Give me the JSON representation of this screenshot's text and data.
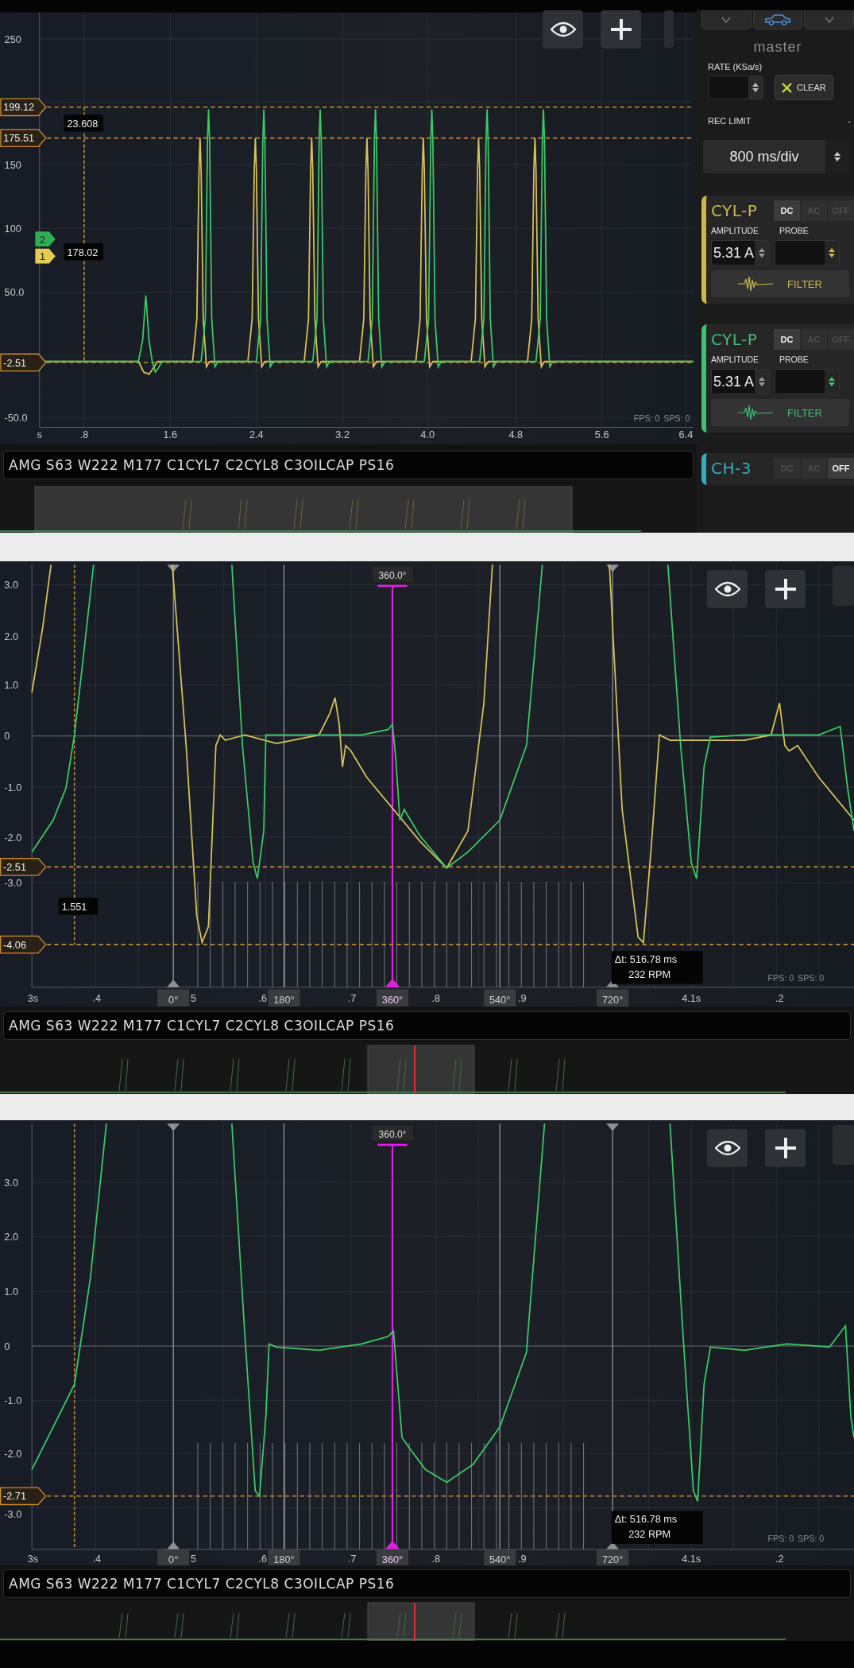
{
  "panels": [
    {
      "kind": "overview",
      "y_ticks": [
        "250",
        "150",
        "100",
        "50.0",
        "-50.0"
      ],
      "x_ticks": [
        "s",
        ".8",
        "1.6",
        "2.4",
        "3.2",
        "4.0",
        "4.8",
        "5.6",
        "6.4"
      ],
      "level_cursors": [
        "199.12",
        "175.51",
        "-2.51"
      ],
      "readouts": [
        "23.608",
        "178.02"
      ],
      "channel_markers": [
        {
          "label": "2",
          "color": "#2fae55"
        },
        {
          "label": "1",
          "color": "#e3cc55"
        }
      ],
      "fps": "FPS: 0",
      "sps": "SPS: 0",
      "title": "AMG S63 W222 M177 C1CYL7 C2CYL8 C3OILCAP PS16"
    },
    {
      "kind": "zoomed",
      "y_ticks": [
        "3.0",
        "2.0",
        "1.0",
        "0",
        "-1.0",
        "-2.0",
        "-3.0"
      ],
      "x_ticks": [
        "3s",
        ".4",
        "5",
        ".6",
        ".7",
        ".8",
        ".9",
        "4.1s",
        ".2"
      ],
      "level_cursors": [
        "-2.51",
        "-4.06"
      ],
      "readouts": [
        "1.551"
      ],
      "angle_markers": [
        "0°",
        "180°",
        "360°",
        "540°",
        "720°"
      ],
      "cursor_label": "360.0°",
      "delta": "Δt: 516.78 ms",
      "rpm": "232 RPM",
      "fps": "FPS: 0",
      "sps": "SPS: 0",
      "title": "AMG S63 W222 M177 C1CYL7 C2CYL8 C3OILCAP PS16"
    },
    {
      "kind": "zoomed",
      "y_ticks": [
        "3.0",
        "2.0",
        "1.0",
        "0",
        "-1.0",
        "-2.0",
        "-3.0"
      ],
      "x_ticks": [
        "3s",
        ".4",
        "5",
        ".6",
        ".7",
        ".8",
        ".9",
        "4.1s",
        ".2"
      ],
      "level_cursors": [
        "-2.71"
      ],
      "angle_markers": [
        "0°",
        "180°",
        "360°",
        "540°",
        "720°"
      ],
      "cursor_label": "360.0°",
      "delta": "Δt: 516.78 ms",
      "rpm": "232 RPM",
      "fps": "FPS: 0",
      "sps": "SPS: 0",
      "title": "AMG S63 W222 M177 C1CYL7 C2CYL8 C3OILCAP PS16"
    }
  ],
  "control_panel": {
    "title": "master",
    "rate_label": "RATE (KSa/s)",
    "clear_button": "CLEAR",
    "rec_limit_label": "REC LIMIT",
    "rec_limit_value": "-",
    "timebase": "800 ms/div",
    "channels": [
      {
        "name": "CYL-P",
        "color": "#c9b94d",
        "expanded": true,
        "amplitude_label": "AMPLITUDE",
        "probe_label": "PROBE",
        "amplitude": "5.31 A",
        "filter": "FILTER",
        "couplings": [
          {
            "label": "DC",
            "selected": true
          },
          {
            "label": "AC",
            "selected": false
          },
          {
            "label": "OFF",
            "selected": false
          }
        ]
      },
      {
        "name": "CYL-P",
        "color": "#3fbf78",
        "expanded": true,
        "amplitude_label": "AMPLITUDE",
        "probe_label": "PROBE",
        "amplitude": "5.31 A",
        "filter": "FILTER",
        "couplings": [
          {
            "label": "DC",
            "selected": true
          },
          {
            "label": "AC",
            "selected": false
          },
          {
            "label": "OFF",
            "selected": false
          }
        ]
      },
      {
        "name": "CH-3",
        "color": "#3aaab8",
        "expanded": false,
        "couplings": [
          {
            "label": "DC",
            "selected": false
          },
          {
            "label": "AC",
            "selected": false
          },
          {
            "label": "OFF",
            "selected": true
          }
        ]
      }
    ]
  }
}
